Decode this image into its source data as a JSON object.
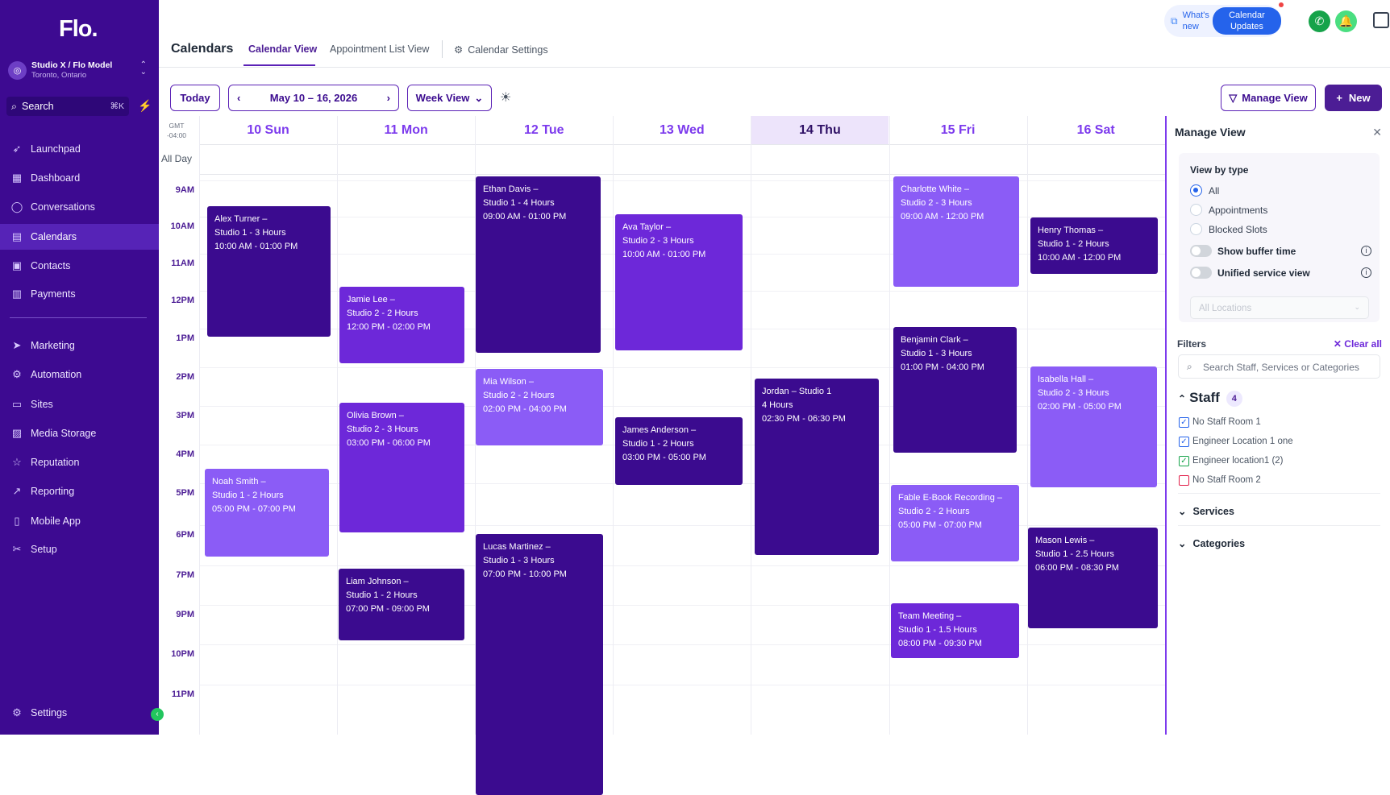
{
  "sidebar": {
    "logo": "Flo.",
    "account": {
      "name": "Studio X / Flo Model",
      "location": "Toronto, Ontario"
    },
    "search": {
      "label": "Search",
      "shortcut": "⌘K"
    },
    "items": [
      {
        "label": "Launchpad",
        "icon": "rocket-icon"
      },
      {
        "label": "Dashboard",
        "icon": "grid-icon"
      },
      {
        "label": "Conversations",
        "icon": "chat-icon"
      },
      {
        "label": "Calendars",
        "icon": "calendar-icon",
        "active": true
      },
      {
        "label": "Contacts",
        "icon": "contacts-icon"
      },
      {
        "label": "Payments",
        "icon": "payments-icon"
      },
      {
        "label": "Marketing",
        "icon": "send-icon"
      },
      {
        "label": "Automation",
        "icon": "automation-icon"
      },
      {
        "label": "Sites",
        "icon": "sites-icon"
      },
      {
        "label": "Media Storage",
        "icon": "media-icon"
      },
      {
        "label": "Reputation",
        "icon": "star-icon"
      },
      {
        "label": "Reporting",
        "icon": "trend-icon"
      },
      {
        "label": "Mobile App",
        "icon": "phone-icon"
      },
      {
        "label": "Setup",
        "icon": "tools-icon"
      }
    ],
    "settings": "Settings"
  },
  "header": {
    "title": "Calendars",
    "tabs": [
      {
        "label": "Calendar View",
        "active": true
      },
      {
        "label": "Appointment List View"
      },
      {
        "label": "Calendar Settings"
      }
    ],
    "whats_new": "What's new",
    "calendar_updates": "Calendar Updates"
  },
  "toolbar": {
    "today": "Today",
    "date_range": "May 10 – 16, 2026",
    "view": "Week View",
    "manage_view": "Manage View",
    "new": "New"
  },
  "calendar": {
    "timezone": "GMT -04:00",
    "all_day": "All Day",
    "days": [
      {
        "label": "10 Sun"
      },
      {
        "label": "11 Mon"
      },
      {
        "label": "12 Tue"
      },
      {
        "label": "13 Wed"
      },
      {
        "label": "14 Thu",
        "today": true
      },
      {
        "label": "15 Fri"
      },
      {
        "label": "16 Sat"
      }
    ],
    "hours": [
      "9AM",
      "10AM",
      "11AM",
      "12PM",
      "1PM",
      "2PM",
      "3PM",
      "4PM",
      "5PM",
      "6PM",
      "7PM",
      "9PM",
      "10PM",
      "11PM"
    ],
    "appointments": [
      {
        "name": "Alex Turner –",
        "detail": "Studio 1 - 3 Hours",
        "time": "10:00 AM - 01:00 PM",
        "day": 0,
        "tone": "dark"
      },
      {
        "name": "Noah Smith –",
        "detail": "Studio 1 - 2 Hours",
        "time": "05:00 PM - 07:00 PM",
        "day": 0,
        "tone": "light"
      },
      {
        "name": "Jamie Lee –",
        "detail": "Studio 2 - 2 Hours",
        "time": "12:00 PM - 02:00 PM",
        "day": 1,
        "tone": "mid"
      },
      {
        "name": "Olivia Brown –",
        "detail": "Studio 2 - 3 Hours",
        "time": "03:00 PM - 06:00 PM",
        "day": 1,
        "tone": "mid"
      },
      {
        "name": "Liam Johnson –",
        "detail": "Studio 1 - 2 Hours",
        "time": "07:00 PM - 09:00 PM",
        "day": 1,
        "tone": "dark"
      },
      {
        "name": "Ethan Davis –",
        "detail": "Studio 1 - 4 Hours",
        "time": "09:00 AM - 01:00 PM",
        "day": 2,
        "tone": "dark"
      },
      {
        "name": "Mia Wilson –",
        "detail": "Studio 2 - 2 Hours",
        "time": "02:00 PM - 04:00 PM",
        "day": 2,
        "tone": "light"
      },
      {
        "name": "Lucas Martinez –",
        "detail": "Studio 1 - 3 Hours",
        "time": "07:00 PM - 10:00 PM",
        "day": 2,
        "tone": "dark"
      },
      {
        "name": "Ava Taylor –",
        "detail": "Studio 2 - 3 Hours",
        "time": "10:00 AM - 01:00 PM",
        "day": 3,
        "tone": "mid"
      },
      {
        "name": "James Anderson –",
        "detail": "Studio 1 - 2 Hours",
        "time": "03:00 PM - 05:00 PM",
        "day": 3,
        "tone": "dark"
      },
      {
        "name": "Jordan – Studio 1",
        "detail": "4 Hours",
        "time": "02:30 PM - 06:30 PM",
        "day": 4,
        "tone": "dark"
      },
      {
        "name": "Charlotte White –",
        "detail": "Studio 2 - 3 Hours",
        "time": "09:00 AM - 12:00 PM",
        "day": 5,
        "tone": "light"
      },
      {
        "name": "Benjamin Clark –",
        "detail": "Studio 1 - 3 Hours",
        "time": "01:00 PM - 04:00 PM",
        "day": 5,
        "tone": "dark"
      },
      {
        "name": "Fable E-Book Recording –",
        "detail": "Studio 2 - 2 Hours",
        "time": "05:00 PM - 07:00 PM",
        "day": 5,
        "tone": "light"
      },
      {
        "name": "Team Meeting –",
        "detail": "Studio 1 - 1.5 Hours",
        "time": "08:00 PM - 09:30 PM",
        "day": 5,
        "tone": "mid"
      },
      {
        "name": "Henry Thomas –",
        "detail": "Studio 1 - 2 Hours",
        "time": "10:00 AM - 12:00 PM",
        "day": 6,
        "tone": "dark"
      },
      {
        "name": "Isabella Hall –",
        "detail": "Studio 2 - 3 Hours",
        "time": "02:00 PM - 05:00 PM",
        "day": 6,
        "tone": "light"
      },
      {
        "name": "Mason Lewis –",
        "detail": "Studio 1 - 2.5 Hours",
        "time": "06:00 PM - 08:30 PM",
        "day": 6,
        "tone": "dark"
      }
    ]
  },
  "manage_view": {
    "title": "Manage View",
    "view_by_type": "View by type",
    "types": [
      {
        "label": "All",
        "selected": true
      },
      {
        "label": "Appointments"
      },
      {
        "label": "Blocked Slots"
      }
    ],
    "show_buffer_time": "Show buffer time",
    "unified_service_view": "Unified service view",
    "locations_placeholder": "All Locations",
    "filters": "Filters",
    "clear_all": "Clear all",
    "search_placeholder": "Search Staff, Services or Categories",
    "staff": {
      "label": "Staff",
      "count": "4",
      "items": [
        {
          "label": "No Staff Room 1",
          "checked": true,
          "color": "#2563eb"
        },
        {
          "label": "Engineer Location 1 one",
          "checked": true,
          "color": "#2563eb"
        },
        {
          "label": "Engineer location1 (2)",
          "checked": true,
          "color": "#16a34a"
        },
        {
          "label": "No Staff Room 2",
          "checked": false,
          "color": "#e11d48"
        }
      ]
    },
    "services": "Services",
    "categories": "Categories"
  },
  "colors": {
    "brand": "#3d0a91",
    "accent": "#5b21b6",
    "appt_dark": "#3b0b8f",
    "appt_mid": "#6d28d9",
    "appt_light": "#8b5cf6"
  }
}
